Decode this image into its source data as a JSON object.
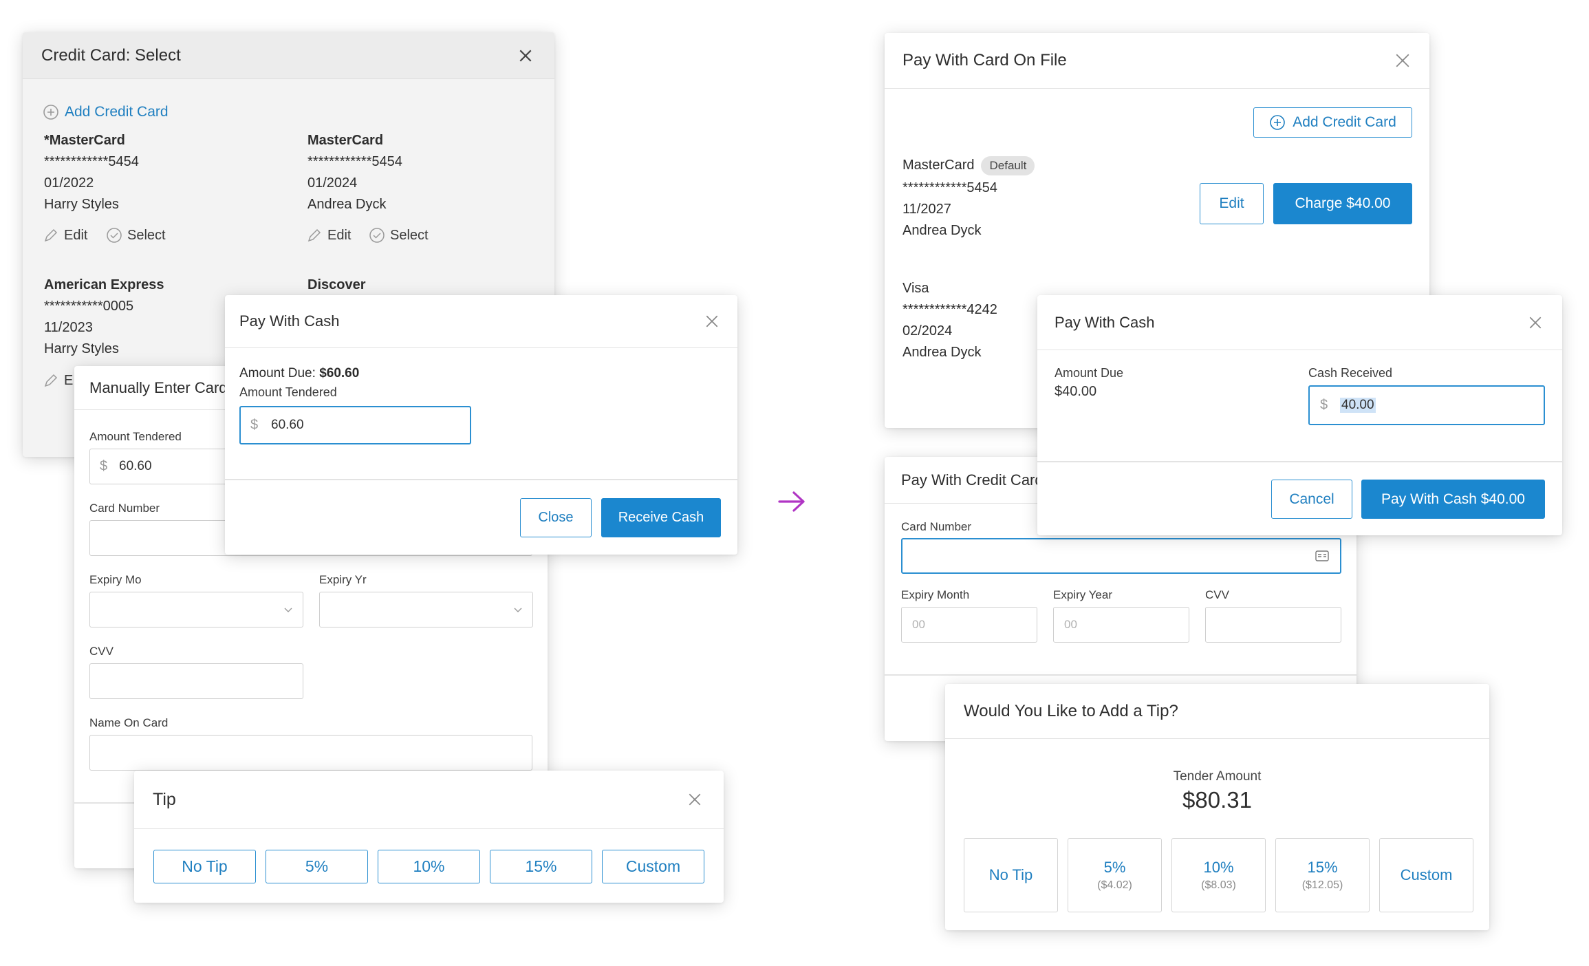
{
  "colors": {
    "accent": "#1b87cf",
    "arrow": "#b035c4",
    "badge_bg": "#e3e3e3"
  },
  "left": {
    "cc_select": {
      "title": "Credit Card: Select",
      "add_card": "Add Credit Card",
      "cards": [
        {
          "name": "*MasterCard",
          "number": "************5454",
          "expiry": "01/2022",
          "holder": "Harry Styles"
        },
        {
          "name": "MasterCard",
          "number": "************5454",
          "expiry": "01/2024",
          "holder": "Andrea Dyck"
        },
        {
          "name": "American Express",
          "number": "***********0005",
          "expiry": "11/2023",
          "holder": "Harry Styles"
        },
        {
          "name": "Discover"
        }
      ],
      "edit": "Edit",
      "select": "Select",
      "partial_edit": "E"
    },
    "manual": {
      "title": "Manually Enter Card",
      "amount_tendered_label": "Amount Tendered",
      "currency": "$",
      "amount_value": "60.60",
      "card_number_label": "Card Number",
      "expiry_mo_label": "Expiry Mo",
      "expiry_yr_label": "Expiry Yr",
      "cvv_label": "CVV",
      "name_label": "Name On Card"
    },
    "cash": {
      "title": "Pay With Cash",
      "amount_due_label": "Amount Due:",
      "amount_due_value": "$60.60",
      "tendered_label": "Amount Tendered",
      "currency": "$",
      "tendered_value": "60.60",
      "close": "Close",
      "receive": "Receive Cash"
    },
    "tip": {
      "title": "Tip",
      "options": [
        "No Tip",
        "5%",
        "10%",
        "15%",
        "Custom"
      ]
    }
  },
  "right": {
    "card_on_file": {
      "title": "Pay With Card On File",
      "add_card": "Add Credit Card",
      "card1": {
        "name": "MasterCard",
        "badge": "Default",
        "number": "************5454",
        "expiry": "11/2027",
        "holder": "Andrea Dyck"
      },
      "edit": "Edit",
      "charge": "Charge $40.00",
      "card2": {
        "name": "Visa",
        "number": "************4242",
        "expiry": "02/2024",
        "holder": "Andrea Dyck"
      }
    },
    "credit_card": {
      "title": "Pay With Credit Card",
      "card_number_label": "Card Number",
      "expiry_month_label": "Expiry Month",
      "expiry_year_label": "Expiry Year",
      "cvv_label": "CVV",
      "expiry_month_placeholder": "00",
      "expiry_year_placeholder": "00"
    },
    "cash": {
      "title": "Pay With Cash",
      "amount_due_label": "Amount Due",
      "amount_due_value": "$40.00",
      "cash_received_label": "Cash Received",
      "currency": "$",
      "cash_value": "40.00",
      "cancel": "Cancel",
      "pay": "Pay With Cash $40.00"
    },
    "tip": {
      "title": "Would You Like to Add a Tip?",
      "tender_label": "Tender Amount",
      "tender_value": "$80.31",
      "options": [
        {
          "label": "No Tip",
          "sub": ""
        },
        {
          "label": "5%",
          "sub": "($4.02)"
        },
        {
          "label": "10%",
          "sub": "($8.03)"
        },
        {
          "label": "15%",
          "sub": "($12.05)"
        },
        {
          "label": "Custom",
          "sub": ""
        }
      ]
    }
  }
}
